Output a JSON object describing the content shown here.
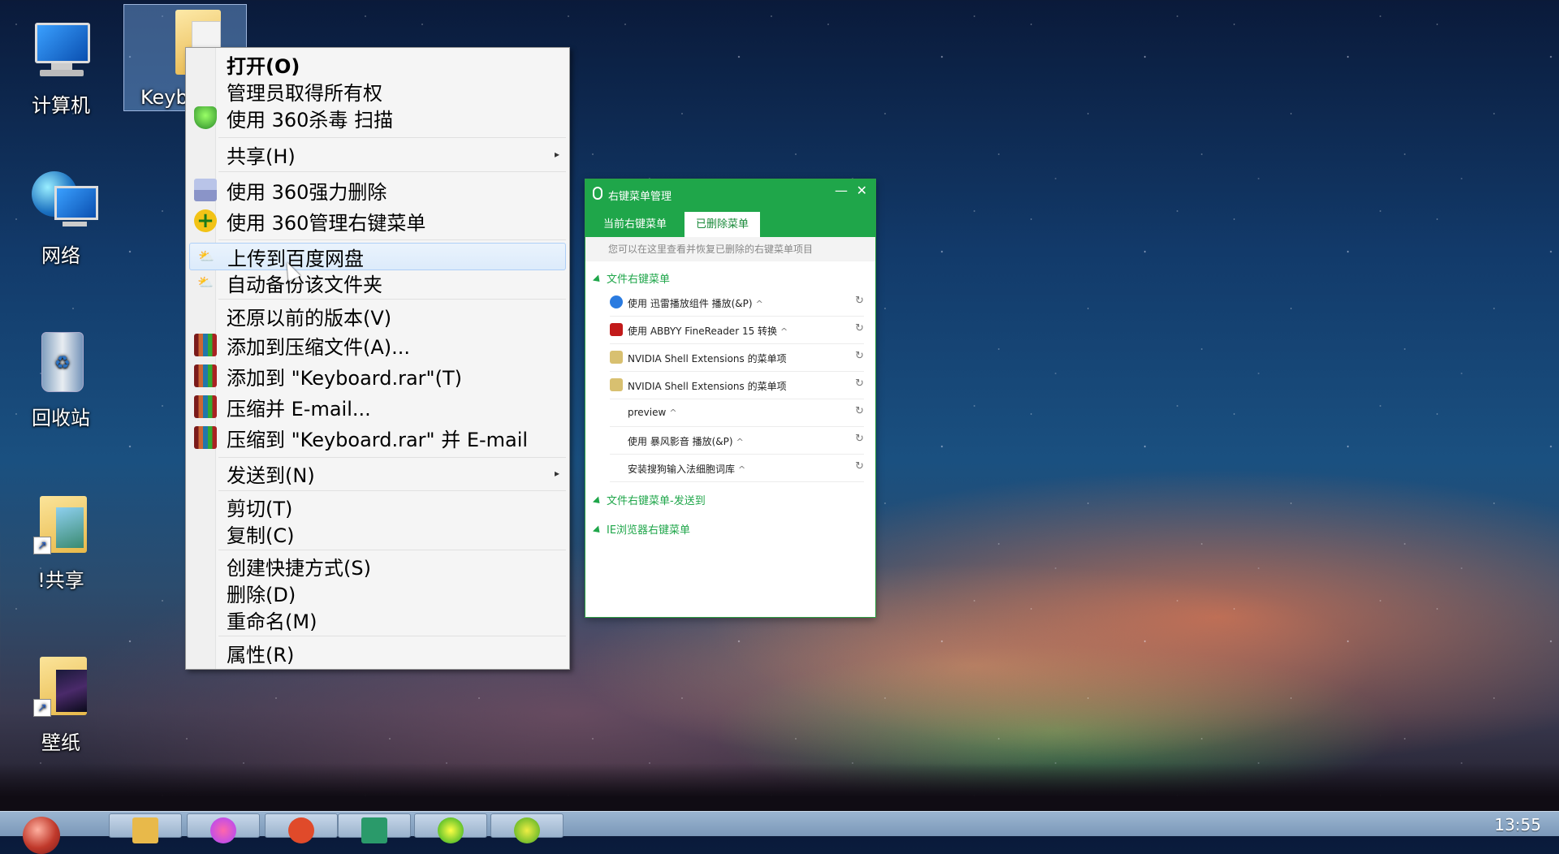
{
  "desktop": {
    "icons": [
      {
        "label": "计算机",
        "icon": "computer-icon"
      },
      {
        "label": "网络",
        "icon": "network-icon"
      },
      {
        "label": "回收站",
        "icon": "recycle-bin-icon"
      },
      {
        "label": "!共享",
        "icon": "folder-shortcut-icon"
      },
      {
        "label": "壁纸",
        "icon": "folder-shortcut-icon"
      },
      {
        "label": "Keyb",
        "icon": "folder-icon"
      }
    ]
  },
  "context_menu": {
    "items": [
      {
        "label": "打开(O)",
        "bold": true
      },
      {
        "label": "管理员取得所有权"
      },
      {
        "label": "使用 360杀毒 扫描",
        "icon": "shield-icon"
      },
      {
        "label": "共享(H)",
        "submenu": true
      },
      {
        "label": "使用 360强力删除",
        "icon": "shredder-icon"
      },
      {
        "label": "使用 360管理右键菜单",
        "icon": "plus-icon"
      },
      {
        "label": "上传到百度网盘",
        "icon": "cloud-icon",
        "hover": true
      },
      {
        "label": "自动备份该文件夹",
        "icon": "cloud-icon"
      },
      {
        "label": "还原以前的版本(V)"
      },
      {
        "label": "添加到压缩文件(A)...",
        "icon": "winrar-icon"
      },
      {
        "label": "添加到 \"Keyboard.rar\"(T)",
        "icon": "winrar-icon"
      },
      {
        "label": "压缩并 E-mail...",
        "icon": "winrar-icon"
      },
      {
        "label": "压缩到 \"Keyboard.rar\" 并 E-mail",
        "icon": "winrar-icon"
      },
      {
        "label": "发送到(N)",
        "submenu": true
      },
      {
        "label": "剪切(T)"
      },
      {
        "label": "复制(C)"
      },
      {
        "label": "创建快捷方式(S)"
      },
      {
        "label": "删除(D)"
      },
      {
        "label": "重命名(M)"
      },
      {
        "label": "属性(R)"
      }
    ],
    "submenu_arrow": "▸"
  },
  "manager_window": {
    "title": "右键菜单管理",
    "minimize": "—",
    "close": "✕",
    "tabs": [
      {
        "label": "当前右键菜单",
        "active": false
      },
      {
        "label": "已删除菜单",
        "active": true
      }
    ],
    "note": "您可以在这里查看并恢复已删除的右键菜单项目",
    "groups": [
      {
        "label": "文件右键菜单"
      },
      {
        "label": "文件右键菜单-发送到"
      },
      {
        "label": "IE浏览器右键菜单"
      }
    ],
    "rows": [
      {
        "label": "使用 迅雷播放组件 播放(&P)",
        "icon": "xunlei-icon",
        "color": "#2a7be0"
      },
      {
        "label": "使用 ABBYY FineReader 15 转换",
        "icon": "abbyy-icon",
        "color": "#c21a1a"
      },
      {
        "label": "NVIDIA Shell Extensions 的菜单项",
        "icon": "nvidia-icon",
        "color": "#d8c070"
      },
      {
        "label": "NVIDIA Shell Extensions 的菜单项",
        "icon": "nvidia-icon",
        "color": "#d8c070"
      },
      {
        "label": "preview",
        "icon": "",
        "color": ""
      },
      {
        "label": "使用 暴风影音 播放(&P)",
        "icon": "",
        "color": ""
      },
      {
        "label": "安装搜狗输入法细胞词库",
        "icon": "",
        "color": ""
      }
    ],
    "caret": "^",
    "restore_icon": "↻"
  },
  "taskbar": {
    "clock": "13:55"
  }
}
